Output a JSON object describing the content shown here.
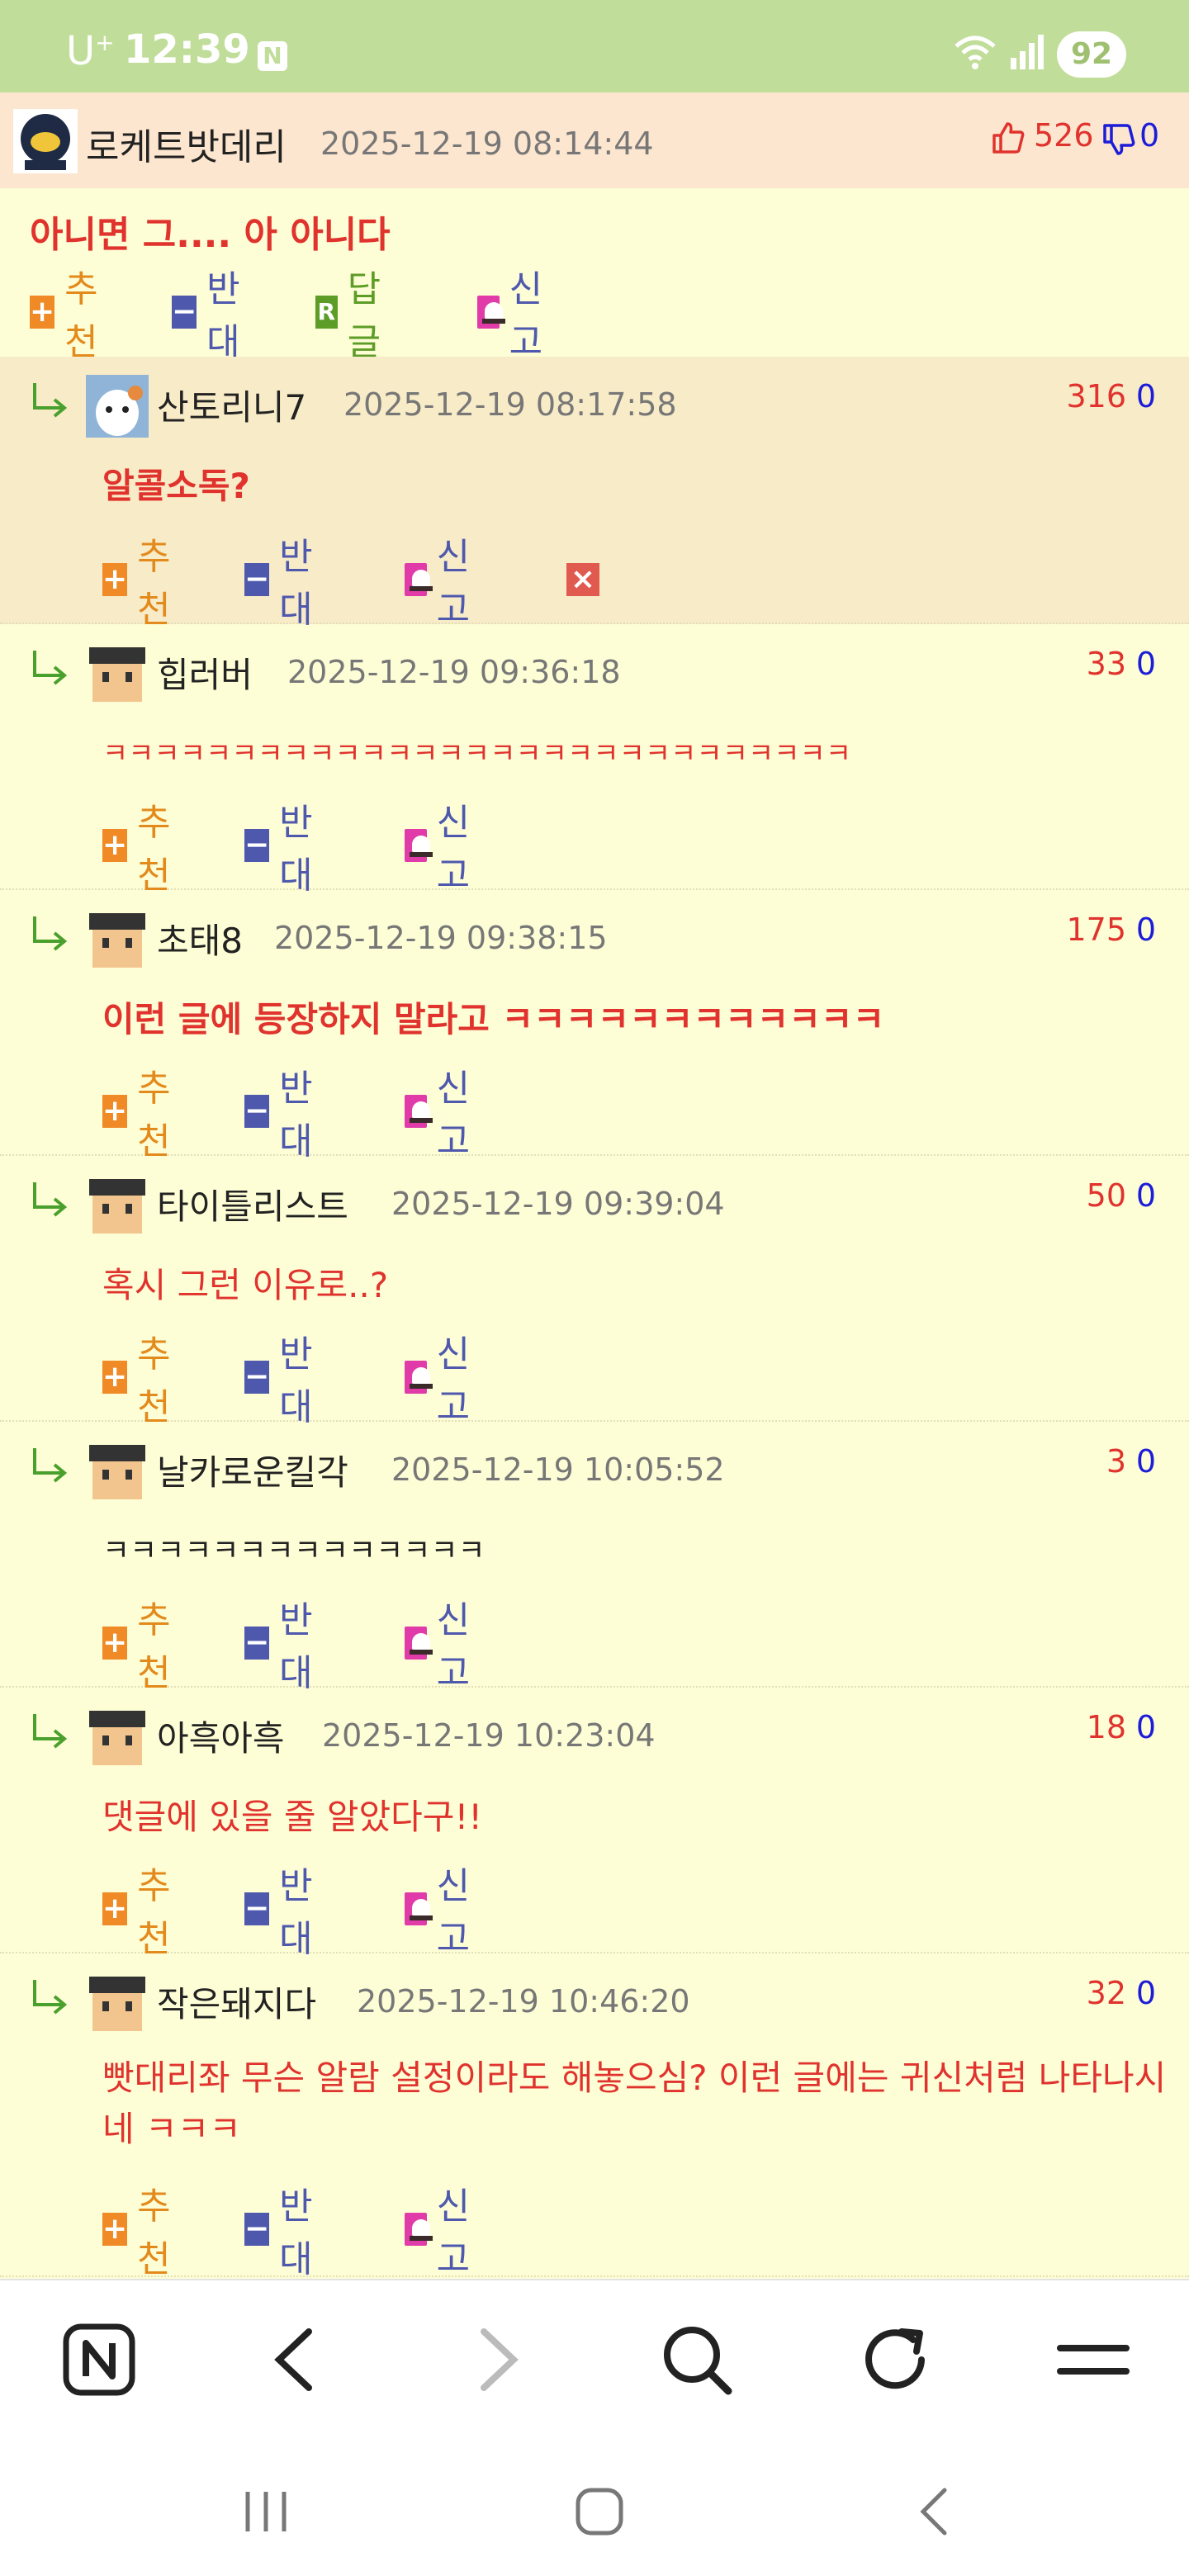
{
  "status_bar": {
    "carrier": "U",
    "carrier_sup": "+",
    "time": "12:39",
    "notification_badge": "N",
    "battery": "92"
  },
  "post": {
    "author": "로케트밧데리",
    "date": "2025-12-19 08:14:44",
    "likes": "526",
    "dislikes": "0",
    "body": "아니면 그.... 아 아니다",
    "actions": {
      "recommend": "추천",
      "oppose": "반대",
      "reply": "답글",
      "reply_badge": "R",
      "report": "신고"
    }
  },
  "action_labels": {
    "recommend": "추천",
    "oppose": "반대",
    "report": "신고"
  },
  "comments": [
    {
      "author": "산토리니7",
      "date": "2025-12-19 08:17:58",
      "up": "316",
      "down": "0",
      "body": "알콜소독?"
    },
    {
      "author": "힙러버",
      "date": "2025-12-19 09:36:18",
      "up": "33",
      "down": "0",
      "body": "ㅋㅋㅋㅋㅋㅋㅋㅋㅋㅋㅋㅋㅋㅋㅋㅋㅋㅋㅋㅋㅋㅋㅋㅋㅋㅋㅋㅋㅋ"
    },
    {
      "author": "초태8",
      "date": "2025-12-19 09:38:15",
      "up": "175",
      "down": "0",
      "body": "이런 글에 등장하지 말라고 ㅋㅋㅋㅋㅋㅋㅋㅋㅋㅋㅋㅋ"
    },
    {
      "author": "타이틀리스트",
      "date": "2025-12-19 09:39:04",
      "up": "50",
      "down": "0",
      "body": "혹시 그런 이유로..?"
    },
    {
      "author": "날카로운킬각",
      "date": "2025-12-19 10:05:52",
      "up": "3",
      "down": "0",
      "body": "ㅋㅋㅋㅋㅋㅋㅋㅋㅋㅋㅋㅋㅋㅋ"
    },
    {
      "author": "아흑아흑",
      "date": "2025-12-19 10:23:04",
      "up": "18",
      "down": "0",
      "body": "댓글에 있을 줄 알았다구!!"
    },
    {
      "author": "작은돼지다",
      "date": "2025-12-19 10:46:20",
      "up": "32",
      "down": "0",
      "body": "빳대리좌 무슨 알람 설정이라도 해놓으심? 이런 글에는 귀신처럼 나타나시네 ㅋㅋㅋ"
    }
  ],
  "colors": {
    "status_bar": "#c1dd9a",
    "page_bg": "#fefed6",
    "post_header_bg": "#fde6cf",
    "highlight_comment_bg": "#f8ebc7",
    "accent_red": "#e0332e",
    "accent_blue": "#1d1dd8"
  },
  "icons": {
    "browser_bar": [
      "naver-home-icon",
      "back-icon",
      "forward-icon",
      "search-icon",
      "refresh-icon",
      "menu-icon"
    ],
    "nav_bar": [
      "recents-icon",
      "home-icon",
      "system-back-icon"
    ]
  }
}
